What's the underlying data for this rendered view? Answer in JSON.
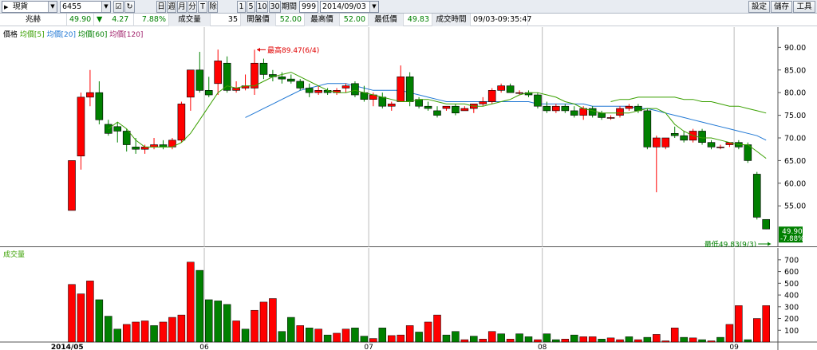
{
  "toolbar": {
    "market_select": "現貨",
    "symbol_input": "6455",
    "period_buttons": [
      "日",
      "週",
      "月",
      "分",
      "T",
      "除"
    ],
    "num_buttons": [
      "1",
      "5",
      "10",
      "30"
    ],
    "period_label": "期間",
    "period_value": "999",
    "date_value": "2014/09/03",
    "right_buttons": [
      "設定",
      "儲存",
      "工具"
    ]
  },
  "quote": {
    "name": "兆赫",
    "price": "49.90",
    "change_arrow": "▼",
    "change": "4.27",
    "change_pct": "7.88%",
    "volume_label": "成交量",
    "volume": "35",
    "open_label": "開盤價",
    "open": "52.00",
    "high_label": "最高價",
    "high": "52.00",
    "low_label": "最低價",
    "low": "49.83",
    "time_label": "成交時間",
    "time": "09/03-09:35:47"
  },
  "price_panel": {
    "legend": [
      {
        "label": "價格",
        "color": "#000000"
      },
      {
        "label": "均價[5]",
        "color": "#3aa000"
      },
      {
        "label": "均價[20]",
        "color": "#1f77d4"
      },
      {
        "label": "均價[60]",
        "color": "#008000"
      },
      {
        "label": "均價[120]",
        "color": "#a0206a"
      }
    ],
    "high_annotation": "最高89.47(6/4)",
    "low_annotation": "最低49.83(9/3)",
    "last_price_tag": "49.90",
    "last_pct_tag": "-7.88%"
  },
  "volume_panel": {
    "legend": "成交量"
  },
  "colors": {
    "up": "#ff0000",
    "down": "#008000",
    "ma5": "#3aa000",
    "ma20": "#1f77d4",
    "ma60": "#3aa000"
  },
  "chart_data": [
    {
      "type": "candlestick",
      "title": "",
      "y_ticks": [
        55,
        60,
        65,
        70,
        75,
        80,
        85,
        90
      ],
      "ylim": [
        48,
        92
      ],
      "x_labels": [
        "2014/05",
        "06",
        "07",
        "08",
        "09"
      ],
      "x_label_index": [
        0,
        15,
        33,
        52,
        73
      ],
      "candles": [
        {
          "o": 54.0,
          "h": 65.0,
          "l": 54.0,
          "c": 65.0
        },
        {
          "o": 66.0,
          "h": 80.0,
          "l": 63.0,
          "c": 79.0
        },
        {
          "o": 79.0,
          "h": 85.0,
          "l": 77.0,
          "c": 80.0
        },
        {
          "o": 80.0,
          "h": 82.5,
          "l": 73.0,
          "c": 74.0
        },
        {
          "o": 73.0,
          "h": 74.0,
          "l": 70.5,
          "c": 71.0
        },
        {
          "o": 72.5,
          "h": 73.5,
          "l": 69.0,
          "c": 71.5
        },
        {
          "o": 71.5,
          "h": 72.0,
          "l": 67.0,
          "c": 68.5
        },
        {
          "o": 68.0,
          "h": 70.0,
          "l": 66.5,
          "c": 67.5
        },
        {
          "o": 67.5,
          "h": 68.5,
          "l": 66.5,
          "c": 68.0
        },
        {
          "o": 68.0,
          "h": 70.0,
          "l": 67.5,
          "c": 68.5
        },
        {
          "o": 68.5,
          "h": 69.5,
          "l": 67.5,
          "c": 68.0
        },
        {
          "o": 68.0,
          "h": 70.0,
          "l": 67.5,
          "c": 69.5
        },
        {
          "o": 69.5,
          "h": 78.0,
          "l": 69.0,
          "c": 77.5
        },
        {
          "o": 79.0,
          "h": 84.0,
          "l": 76.0,
          "c": 85.0
        },
        {
          "o": 85.0,
          "h": 89.0,
          "l": 80.0,
          "c": 80.5
        },
        {
          "o": 80.5,
          "h": 83.5,
          "l": 79.0,
          "c": 79.5
        },
        {
          "o": 82.0,
          "h": 89.5,
          "l": 79.5,
          "c": 87.0
        },
        {
          "o": 86.5,
          "h": 88.0,
          "l": 80.0,
          "c": 80.5
        },
        {
          "o": 80.5,
          "h": 82.5,
          "l": 80.0,
          "c": 81.0
        },
        {
          "o": 81.0,
          "h": 84.0,
          "l": 80.5,
          "c": 81.5
        },
        {
          "o": 81.0,
          "h": 89.47,
          "l": 79.5,
          "c": 86.5
        },
        {
          "o": 86.5,
          "h": 87.5,
          "l": 83.0,
          "c": 84.0
        },
        {
          "o": 84.0,
          "h": 85.0,
          "l": 82.5,
          "c": 83.5
        },
        {
          "o": 83.5,
          "h": 84.5,
          "l": 82.0,
          "c": 83.0
        },
        {
          "o": 83.0,
          "h": 84.0,
          "l": 82.0,
          "c": 82.5
        },
        {
          "o": 82.5,
          "h": 83.0,
          "l": 80.5,
          "c": 81.0
        },
        {
          "o": 81.0,
          "h": 82.0,
          "l": 79.0,
          "c": 80.0
        },
        {
          "o": 80.0,
          "h": 81.5,
          "l": 79.5,
          "c": 80.5
        },
        {
          "o": 80.5,
          "h": 81.0,
          "l": 79.5,
          "c": 80.0
        },
        {
          "o": 80.0,
          "h": 81.0,
          "l": 79.5,
          "c": 80.5
        },
        {
          "o": 81.0,
          "h": 82.0,
          "l": 80.0,
          "c": 81.5
        },
        {
          "o": 82.0,
          "h": 82.5,
          "l": 79.0,
          "c": 79.5
        },
        {
          "o": 80.0,
          "h": 81.5,
          "l": 78.0,
          "c": 78.5
        },
        {
          "o": 78.5,
          "h": 80.0,
          "l": 77.0,
          "c": 79.5
        },
        {
          "o": 79.0,
          "h": 80.0,
          "l": 76.5,
          "c": 77.0
        },
        {
          "o": 77.0,
          "h": 78.0,
          "l": 76.0,
          "c": 77.5
        },
        {
          "o": 78.0,
          "h": 86.0,
          "l": 78.0,
          "c": 83.5
        },
        {
          "o": 83.5,
          "h": 84.5,
          "l": 77.0,
          "c": 78.0
        },
        {
          "o": 78.5,
          "h": 79.0,
          "l": 76.5,
          "c": 77.0
        },
        {
          "o": 77.0,
          "h": 78.0,
          "l": 76.0,
          "c": 76.5
        },
        {
          "o": 76.0,
          "h": 77.0,
          "l": 74.5,
          "c": 75.0
        },
        {
          "o": 76.5,
          "h": 77.0,
          "l": 76.0,
          "c": 77.0
        },
        {
          "o": 77.0,
          "h": 77.5,
          "l": 75.0,
          "c": 75.5
        },
        {
          "o": 76.0,
          "h": 77.0,
          "l": 76.0,
          "c": 76.5
        },
        {
          "o": 76.5,
          "h": 77.5,
          "l": 75.5,
          "c": 77.5
        },
        {
          "o": 77.5,
          "h": 79.0,
          "l": 77.0,
          "c": 78.0
        },
        {
          "o": 78.0,
          "h": 81.0,
          "l": 77.5,
          "c": 80.5
        },
        {
          "o": 80.5,
          "h": 82.0,
          "l": 80.0,
          "c": 81.5
        },
        {
          "o": 81.5,
          "h": 82.0,
          "l": 80.0,
          "c": 80.0
        },
        {
          "o": 80.0,
          "h": 80.5,
          "l": 79.5,
          "c": 80.0
        },
        {
          "o": 80.0,
          "h": 80.5,
          "l": 79.0,
          "c": 79.5
        },
        {
          "o": 79.5,
          "h": 80.0,
          "l": 76.5,
          "c": 77.0
        },
        {
          "o": 77.0,
          "h": 78.0,
          "l": 75.5,
          "c": 76.0
        },
        {
          "o": 76.0,
          "h": 77.5,
          "l": 75.5,
          "c": 77.0
        },
        {
          "o": 77.0,
          "h": 77.5,
          "l": 75.5,
          "c": 76.0
        },
        {
          "o": 76.0,
          "h": 77.0,
          "l": 74.5,
          "c": 75.0
        },
        {
          "o": 75.0,
          "h": 77.0,
          "l": 74.0,
          "c": 76.5
        },
        {
          "o": 76.5,
          "h": 77.0,
          "l": 74.5,
          "c": 75.0
        },
        {
          "o": 75.5,
          "h": 76.0,
          "l": 74.0,
          "c": 74.5
        },
        {
          "o": 74.5,
          "h": 75.0,
          "l": 74.0,
          "c": 74.5
        },
        {
          "o": 75.0,
          "h": 77.0,
          "l": 74.5,
          "c": 76.5
        },
        {
          "o": 76.5,
          "h": 77.5,
          "l": 76.0,
          "c": 77.0
        },
        {
          "o": 77.0,
          "h": 77.5,
          "l": 75.5,
          "c": 76.0
        },
        {
          "o": 76.0,
          "h": 76.5,
          "l": 67.5,
          "c": 68.0
        },
        {
          "o": 68.0,
          "h": 70.5,
          "l": 58.0,
          "c": 70.0
        },
        {
          "o": 68.0,
          "h": 70.0,
          "l": 67.5,
          "c": 70.0
        },
        {
          "o": 71.0,
          "h": 72.5,
          "l": 70.0,
          "c": 70.5
        },
        {
          "o": 70.5,
          "h": 71.5,
          "l": 69.0,
          "c": 69.5
        },
        {
          "o": 69.5,
          "h": 72.0,
          "l": 69.0,
          "c": 71.5
        },
        {
          "o": 71.5,
          "h": 72.0,
          "l": 68.5,
          "c": 69.0
        },
        {
          "o": 69.0,
          "h": 69.5,
          "l": 67.5,
          "c": 68.0
        },
        {
          "o": 68.0,
          "h": 68.5,
          "l": 67.5,
          "c": 68.0
        },
        {
          "o": 68.5,
          "h": 69.0,
          "l": 68.0,
          "c": 69.0
        },
        {
          "o": 69.0,
          "h": 69.5,
          "l": 67.5,
          "c": 68.0
        },
        {
          "o": 68.5,
          "h": 69.0,
          "l": 64.5,
          "c": 65.0
        },
        {
          "o": 62.0,
          "h": 62.5,
          "l": 52.0,
          "c": 52.5
        },
        {
          "o": 52.0,
          "h": 52.0,
          "l": 49.83,
          "c": 49.9
        }
      ],
      "ma5": [
        null,
        null,
        null,
        null,
        72.0,
        73.5,
        72.0,
        69.5,
        68.0,
        68.0,
        68.0,
        68.0,
        69.0,
        71.0,
        74.0,
        77.0,
        80.0,
        81.5,
        81.0,
        81.5,
        81.5,
        82.5,
        83.5,
        84.0,
        84.5,
        83.5,
        82.5,
        81.5,
        80.5,
        80.0,
        80.0,
        80.5,
        80.0,
        79.5,
        79.0,
        78.5,
        78.0,
        78.0,
        78.5,
        78.5,
        78.0,
        77.5,
        77.5,
        77.5,
        77.0,
        77.0,
        77.5,
        78.0,
        78.5,
        79.5,
        80.0,
        80.0,
        79.5,
        79.0,
        78.0,
        77.5,
        76.5,
        76.0,
        75.5,
        75.5,
        75.5,
        75.5,
        76.0,
        76.5,
        76.5,
        75.5,
        73.0,
        71.5,
        70.5,
        70.0,
        70.0,
        69.5,
        69.0,
        68.5,
        68.5,
        67.0,
        65.5
      ],
      "ma20": [
        null,
        null,
        null,
        null,
        null,
        null,
        null,
        null,
        null,
        null,
        null,
        null,
        null,
        null,
        null,
        null,
        null,
        null,
        null,
        74.5,
        75.5,
        76.5,
        77.5,
        78.5,
        79.5,
        80.5,
        81.0,
        81.5,
        82.0,
        82.0,
        82.0,
        81.5,
        81.0,
        80.5,
        80.5,
        80.5,
        80.5,
        80.0,
        79.5,
        79.0,
        78.5,
        78.0,
        78.0,
        78.0,
        78.0,
        78.0,
        78.0,
        78.0,
        78.0,
        78.0,
        78.0,
        77.5,
        77.5,
        77.5,
        77.5,
        77.5,
        77.5,
        77.0,
        77.0,
        77.0,
        77.0,
        77.0,
        76.5,
        76.5,
        76.0,
        75.5,
        75.0,
        74.5,
        74.0,
        73.5,
        73.0,
        72.5,
        72.0,
        71.5,
        71.0,
        70.5,
        69.5
      ],
      "ma60": [
        null,
        null,
        null,
        null,
        null,
        null,
        null,
        null,
        null,
        null,
        null,
        null,
        null,
        null,
        null,
        null,
        null,
        null,
        null,
        null,
        null,
        null,
        null,
        null,
        null,
        null,
        null,
        null,
        null,
        null,
        null,
        null,
        null,
        null,
        null,
        null,
        null,
        null,
        null,
        null,
        null,
        null,
        null,
        null,
        null,
        null,
        null,
        null,
        null,
        null,
        null,
        null,
        null,
        null,
        null,
        null,
        null,
        null,
        null,
        78.0,
        78.5,
        78.5,
        79.0,
        79.0,
        79.0,
        79.0,
        79.0,
        78.5,
        78.5,
        78.0,
        78.0,
        77.5,
        77.0,
        77.0,
        76.5,
        76.0,
        75.5
      ]
    },
    {
      "type": "bar",
      "title": "",
      "y_ticks": [
        100,
        200,
        300,
        400,
        500,
        600,
        700
      ],
      "ylim": [
        0,
        760
      ],
      "values": [
        490,
        410,
        520,
        360,
        220,
        110,
        150,
        170,
        180,
        140,
        170,
        210,
        230,
        680,
        610,
        360,
        350,
        320,
        180,
        110,
        270,
        340,
        370,
        90,
        210,
        140,
        120,
        110,
        60,
        75,
        110,
        120,
        50,
        30,
        120,
        55,
        60,
        140,
        85,
        170,
        230,
        60,
        90,
        20,
        50,
        25,
        90,
        70,
        25,
        70,
        45,
        20,
        70,
        20,
        25,
        60,
        45,
        45,
        25,
        35,
        20,
        45,
        20,
        40,
        65,
        10,
        120,
        40,
        35,
        20,
        10,
        40,
        150,
        310,
        20,
        200,
        310
      ],
      "colors": [
        "up",
        "up",
        "up",
        "down",
        "down",
        "down",
        "up",
        "up",
        "up",
        "down",
        "up",
        "up",
        "up",
        "up",
        "down",
        "down",
        "down",
        "down",
        "up",
        "down",
        "up",
        "up",
        "up",
        "down",
        "down",
        "up",
        "down",
        "up",
        "down",
        "up",
        "up",
        "down",
        "down",
        "up",
        "down",
        "up",
        "up",
        "up",
        "down",
        "up",
        "up",
        "down",
        "down",
        "up",
        "down",
        "up",
        "up",
        "down",
        "up",
        "down",
        "down",
        "up",
        "down",
        "down",
        "up",
        "down",
        "up",
        "up",
        "down",
        "up",
        "up",
        "down",
        "up",
        "down",
        "up",
        "up",
        "up",
        "down",
        "up",
        "down",
        "up",
        "down",
        "up",
        "up",
        "down",
        "up",
        "up"
      ]
    }
  ]
}
